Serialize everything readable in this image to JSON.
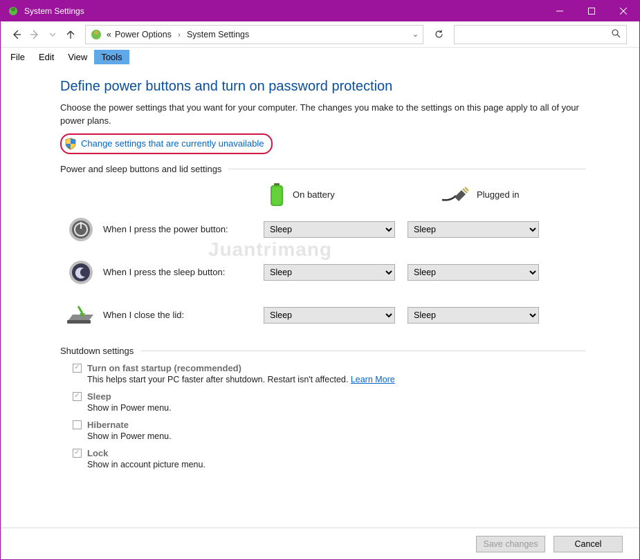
{
  "window": {
    "title": "System Settings"
  },
  "breadcrumb": {
    "prefix": "«",
    "items": [
      "Power Options",
      "System Settings"
    ]
  },
  "menubar": {
    "items": [
      "File",
      "Edit",
      "View",
      "Tools"
    ],
    "active": 3
  },
  "page": {
    "heading": "Define power buttons and turn on password protection",
    "description": "Choose the power settings that you want for your computer. The changes you make to the settings on this page apply to all of your power plans.",
    "uac_link": "Change settings that are currently unavailable"
  },
  "power_section": {
    "title": "Power and sleep buttons and lid settings",
    "columns": {
      "battery": "On battery",
      "plugged": "Plugged in"
    },
    "rows": [
      {
        "label": "When I press the power button:",
        "battery": "Sleep",
        "plugged": "Sleep"
      },
      {
        "label": "When I press the sleep button:",
        "battery": "Sleep",
        "plugged": "Sleep"
      },
      {
        "label": "When I close the lid:",
        "battery": "Sleep",
        "plugged": "Sleep"
      }
    ]
  },
  "shutdown_section": {
    "title": "Shutdown settings",
    "options": [
      {
        "checked": true,
        "label": "Turn on fast startup (recommended)",
        "sub": "This helps start your PC faster after shutdown. Restart isn't affected.",
        "link": "Learn More"
      },
      {
        "checked": true,
        "label": "Sleep",
        "sub": "Show in Power menu."
      },
      {
        "checked": false,
        "label": "Hibernate",
        "sub": "Show in Power menu."
      },
      {
        "checked": true,
        "label": "Lock",
        "sub": "Show in account picture menu."
      }
    ]
  },
  "buttons": {
    "save": "Save changes",
    "cancel": "Cancel"
  },
  "watermark": "Juantrimang"
}
